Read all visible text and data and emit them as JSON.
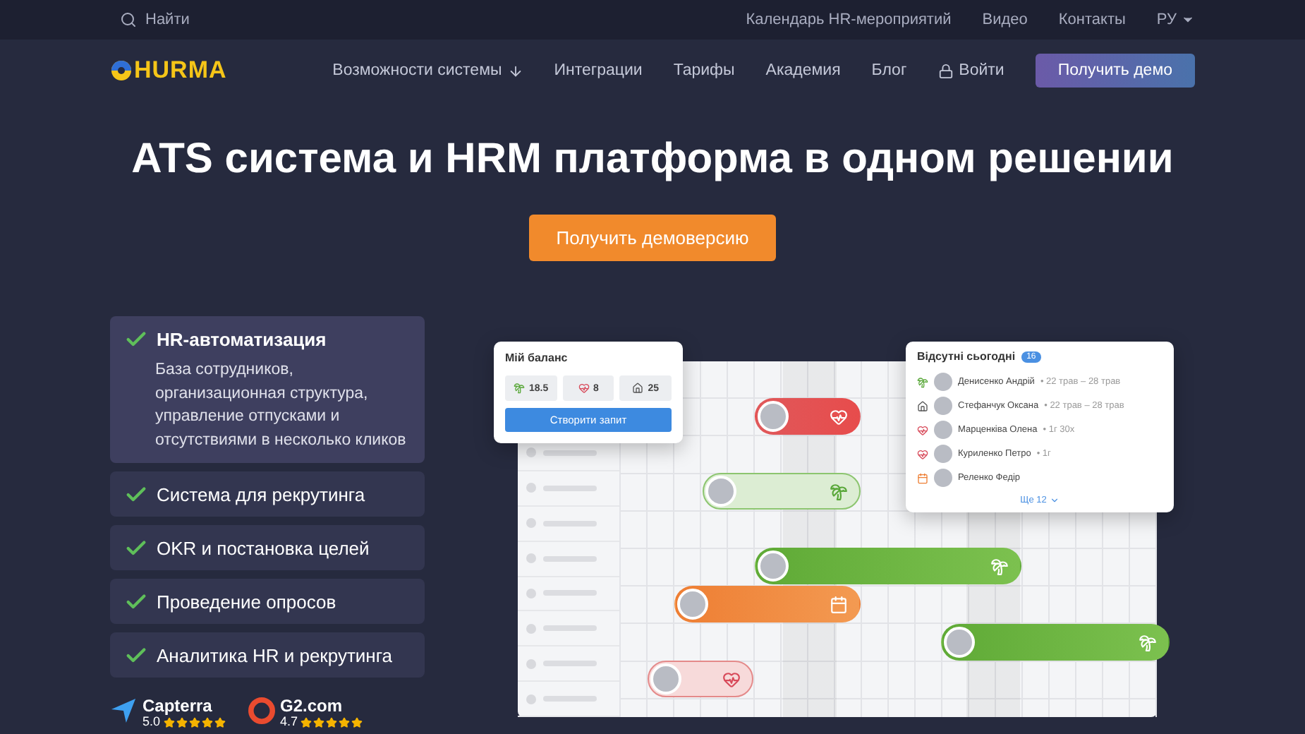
{
  "top_bar": {
    "search": {
      "placeholder": "Найти"
    },
    "links": [
      "Календарь HR-мероприятий",
      "Видео",
      "Контакты"
    ],
    "language": "РУ"
  },
  "nav": {
    "logo": "HURMA",
    "items": [
      {
        "label": "Возможности системы",
        "has_arrow": true
      },
      {
        "label": "Интеграции",
        "has_arrow": false
      },
      {
        "label": "Тарифы",
        "has_arrow": false
      },
      {
        "label": "Академия",
        "has_arrow": false
      },
      {
        "label": "Блог",
        "has_arrow": false
      }
    ],
    "login": "Войти",
    "cta": "Получить демо"
  },
  "hero": {
    "title": "ATS система и HRM платформа в одном решении",
    "cta": "Получить демоверсию"
  },
  "features": [
    {
      "title": "HR-автоматизация",
      "description": "База сотрудников, организационная структура, управление отпусками и отсутствиями в несколько кликов",
      "expanded": true
    },
    {
      "title": "Система для рекрутинга",
      "expanded": false
    },
    {
      "title": "OKR и постановка целей",
      "expanded": false
    },
    {
      "title": "Проведение опросов",
      "expanded": false
    },
    {
      "title": "Аналитика HR и рекрутинга",
      "expanded": false
    }
  ],
  "ratings": [
    {
      "name": "Capterra",
      "score": "5.0",
      "stars": 5
    },
    {
      "name": "G2.com",
      "score": "4.7",
      "stars": 5
    }
  ],
  "mockup": {
    "balance": {
      "title": "Мій баланс",
      "stats": [
        {
          "kind": "vacation",
          "value": "18.5"
        },
        {
          "kind": "sick",
          "value": "8"
        },
        {
          "kind": "remote",
          "value": "25"
        }
      ],
      "button": "Створити запит"
    },
    "absent": {
      "title": "Відсутні сьогодні",
      "count": "16",
      "people": [
        {
          "kind": "vacation",
          "name": "Денисенко Андрій",
          "detail": "• 22 трав – 28 трав"
        },
        {
          "kind": "remote",
          "name": "Стефанчук Оксана",
          "detail": "• 22 трав – 28 трав"
        },
        {
          "kind": "sick",
          "name": "Марценківа Олена",
          "detail": "• 1г 30х"
        },
        {
          "kind": "sick",
          "name": "Куриленко Петро",
          "detail": "• 1г"
        },
        {
          "kind": "dayoff",
          "name": "Реленко Федір"
        }
      ],
      "more": "Ще 12"
    },
    "bars": [
      {
        "kind": "sick",
        "faded": false
      },
      {
        "kind": "vacation",
        "faded": true
      },
      {
        "kind": "vacation",
        "faded": false
      },
      {
        "kind": "dayoff",
        "faded": false
      },
      {
        "kind": "vacation",
        "faded": false
      },
      {
        "kind": "sick",
        "faded": true
      }
    ]
  }
}
